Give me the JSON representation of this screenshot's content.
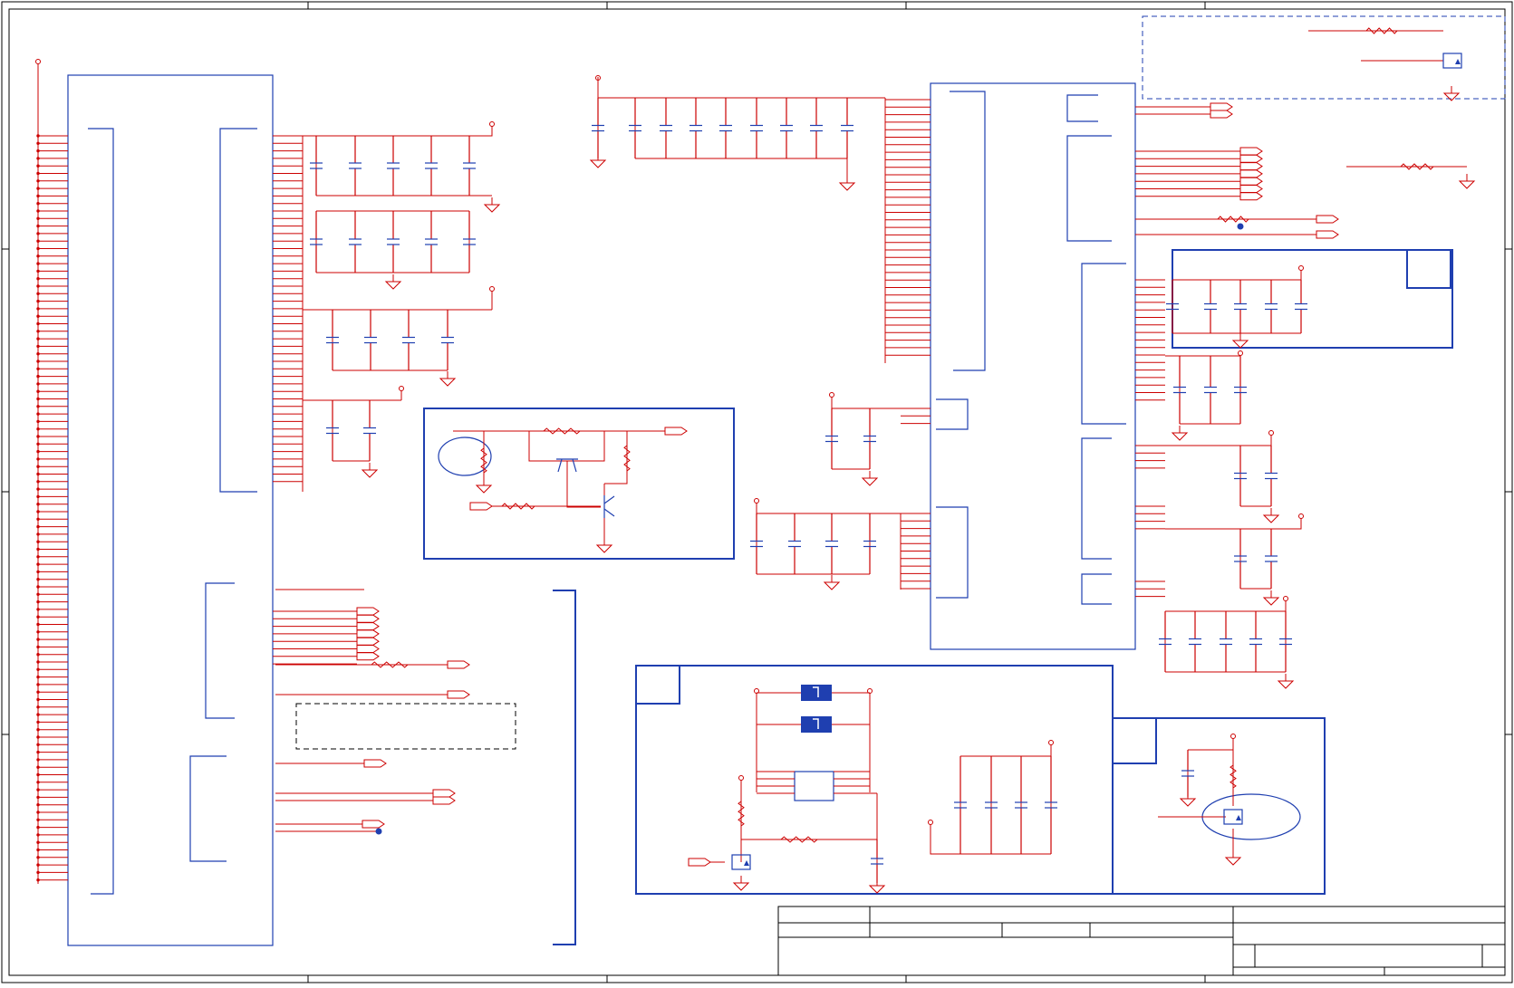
{
  "document": {
    "type": "electronic schematic sheet",
    "title_block": {
      "title": "",
      "size": "",
      "document_number": "",
      "revision": "",
      "date": "",
      "sheet": ""
    }
  },
  "colors": {
    "wire": "#cc0000",
    "component": "#1f3fb0",
    "frame": "#000000",
    "power_symbol": "#cc0000",
    "highlight_fill": "#1f3fb0"
  },
  "icons": {
    "ground": "ground-icon",
    "power_rail": "power-rail-icon",
    "capacitor": "capacitor-icon",
    "resistor": "resistor-icon",
    "mosfet": "mosfet-icon",
    "transistor": "transistor-icon",
    "off_page_connector": "off-page-connector-icon"
  }
}
